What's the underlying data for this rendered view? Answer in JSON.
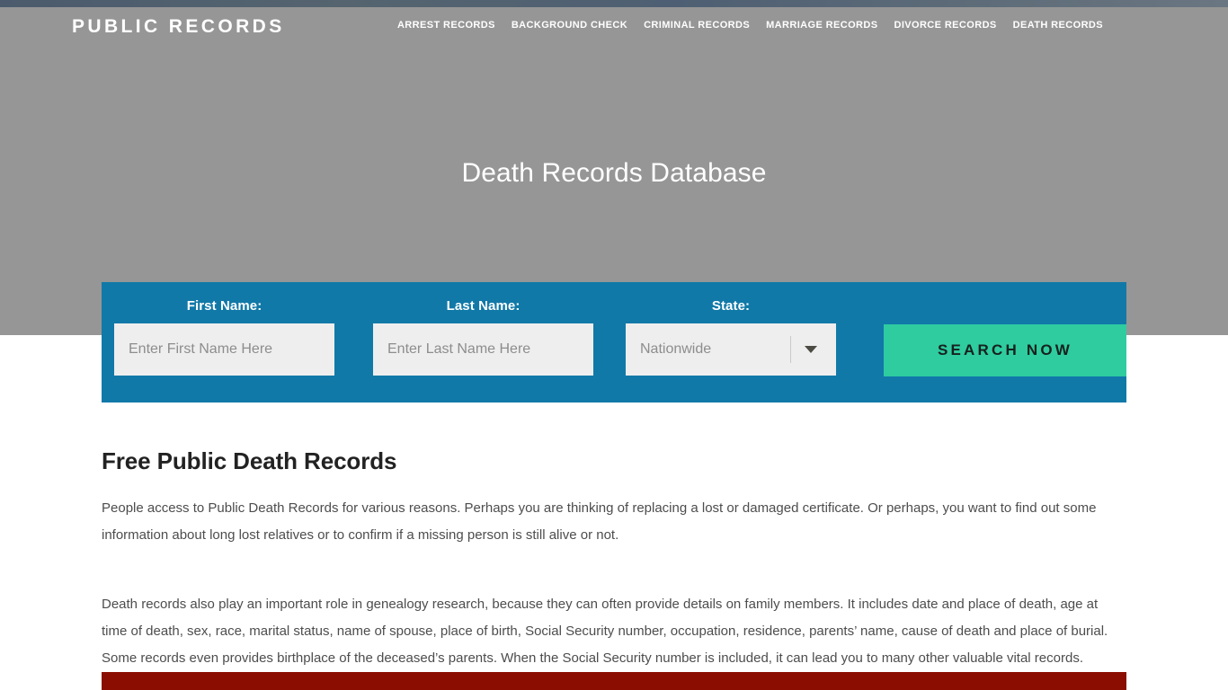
{
  "header": {
    "logo": "PUBLIC RECORDS",
    "nav": [
      {
        "label": "ARREST RECORDS"
      },
      {
        "label": "BACKGROUND CHECK"
      },
      {
        "label": "CRIMINAL RECORDS"
      },
      {
        "label": "MARRIAGE RECORDS"
      },
      {
        "label": "DIVORCE RECORDS"
      },
      {
        "label": "DEATH RECORDS"
      }
    ]
  },
  "hero": {
    "title": "Death Records Database"
  },
  "search": {
    "first_name_label": "First Name:",
    "first_name_placeholder": "Enter First Name Here",
    "first_name_value": "",
    "last_name_label": "Last Name:",
    "last_name_placeholder": "Enter Last Name Here",
    "last_name_value": "",
    "state_label": "State:",
    "state_selected": "Nationwide",
    "submit_label": "SEARCH NOW",
    "panel_color": "#1179a8",
    "button_color": "#2ECC9F"
  },
  "main": {
    "heading": "Free Public Death Records",
    "paragraph_1": "People access to Public Death Records for various reasons. Perhaps you are thinking of replacing a lost or damaged certificate. Or perhaps, you want to find out some information about long lost relatives or to confirm if a missing person is still alive or not.",
    "paragraph_2": "Death records also play an important role in genealogy research, because they can often provide details on family members. It includes date and place of death, age at time of death, sex, race, marital status, name of spouse, place of birth, Social Security number, occupation, residence, parents’ name, cause of death and place of burial. Some records even provides birthplace of the deceased’s parents. When the Social Security number is included, it can lead you to many other valuable vital records."
  },
  "footer_bar": {
    "color": "#8b0d02"
  }
}
